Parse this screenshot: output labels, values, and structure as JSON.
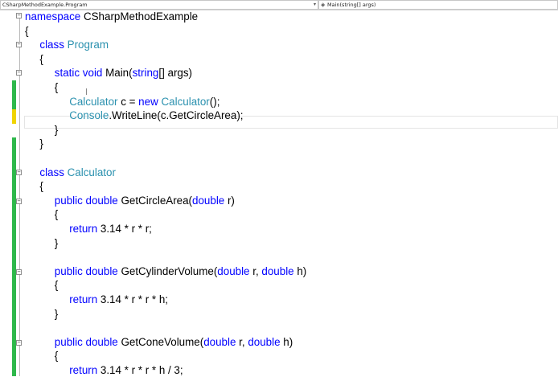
{
  "navbar": {
    "type_dropdown": "CSharpMethodExample.Program",
    "member_dropdown": "Main(string[] args)",
    "member_icon": "method-icon"
  },
  "code": {
    "lines": [
      {
        "indent": 0,
        "tokens": [
          {
            "t": "namespace",
            "c": "kw"
          },
          {
            "t": " CSharpMethodExample"
          }
        ]
      },
      {
        "indent": 0,
        "tokens": [
          {
            "t": "{"
          }
        ]
      },
      {
        "indent": 1,
        "tokens": [
          {
            "t": "class",
            "c": "kw"
          },
          {
            "t": " "
          },
          {
            "t": "Program",
            "c": "ty"
          }
        ]
      },
      {
        "indent": 1,
        "tokens": [
          {
            "t": "{"
          }
        ]
      },
      {
        "indent": 2,
        "tokens": [
          {
            "t": "static",
            "c": "kw"
          },
          {
            "t": " "
          },
          {
            "t": "void",
            "c": "kw"
          },
          {
            "t": " Main("
          },
          {
            "t": "string",
            "c": "kw"
          },
          {
            "t": "[] args)"
          }
        ]
      },
      {
        "indent": 2,
        "tokens": [
          {
            "t": "{"
          }
        ]
      },
      {
        "indent": 3,
        "tokens": [
          {
            "t": "Calculator",
            "c": "ty"
          },
          {
            "t": " c = "
          },
          {
            "t": "new",
            "c": "kw"
          },
          {
            "t": " "
          },
          {
            "t": "Calculator",
            "c": "ty"
          },
          {
            "t": "();"
          }
        ]
      },
      {
        "indent": 3,
        "tokens": [
          {
            "t": "Console",
            "c": "ty"
          },
          {
            "t": ".WriteLine(c.GetCircleArea);"
          }
        ]
      },
      {
        "indent": 2,
        "tokens": [
          {
            "t": "}"
          }
        ]
      },
      {
        "indent": 1,
        "tokens": [
          {
            "t": "}"
          }
        ]
      },
      {
        "indent": 0,
        "tokens": []
      },
      {
        "indent": 1,
        "tokens": [
          {
            "t": "class",
            "c": "kw"
          },
          {
            "t": " "
          },
          {
            "t": "Calculator",
            "c": "ty"
          }
        ]
      },
      {
        "indent": 1,
        "tokens": [
          {
            "t": "{"
          }
        ]
      },
      {
        "indent": 2,
        "tokens": [
          {
            "t": "public",
            "c": "kw"
          },
          {
            "t": " "
          },
          {
            "t": "double",
            "c": "kw"
          },
          {
            "t": " GetCircleArea("
          },
          {
            "t": "double",
            "c": "kw"
          },
          {
            "t": " r)"
          }
        ]
      },
      {
        "indent": 2,
        "tokens": [
          {
            "t": "{"
          }
        ]
      },
      {
        "indent": 3,
        "tokens": [
          {
            "t": "return",
            "c": "kw"
          },
          {
            "t": " 3.14 * r * r;"
          }
        ]
      },
      {
        "indent": 2,
        "tokens": [
          {
            "t": "}"
          }
        ]
      },
      {
        "indent": 0,
        "tokens": []
      },
      {
        "indent": 2,
        "tokens": [
          {
            "t": "public",
            "c": "kw"
          },
          {
            "t": " "
          },
          {
            "t": "double",
            "c": "kw"
          },
          {
            "t": " GetCylinderVolume("
          },
          {
            "t": "double",
            "c": "kw"
          },
          {
            "t": " r, "
          },
          {
            "t": "double",
            "c": "kw"
          },
          {
            "t": " h)"
          }
        ]
      },
      {
        "indent": 2,
        "tokens": [
          {
            "t": "{"
          }
        ]
      },
      {
        "indent": 3,
        "tokens": [
          {
            "t": "return",
            "c": "kw"
          },
          {
            "t": " 3.14 * r * r * h;"
          }
        ]
      },
      {
        "indent": 2,
        "tokens": [
          {
            "t": "}"
          }
        ]
      },
      {
        "indent": 0,
        "tokens": []
      },
      {
        "indent": 2,
        "tokens": [
          {
            "t": "public",
            "c": "kw"
          },
          {
            "t": " "
          },
          {
            "t": "double",
            "c": "kw"
          },
          {
            "t": " GetConeVolume("
          },
          {
            "t": "double",
            "c": "kw"
          },
          {
            "t": " r, "
          },
          {
            "t": "double",
            "c": "kw"
          },
          {
            "t": " h)"
          }
        ]
      },
      {
        "indent": 2,
        "tokens": [
          {
            "t": "{"
          }
        ]
      },
      {
        "indent": 3,
        "tokens": [
          {
            "t": "return",
            "c": "kw"
          },
          {
            "t": " 3.14 * r * r * h / 3;"
          }
        ]
      }
    ]
  },
  "colors": {
    "keyword": "#0000ff",
    "type": "#2b91af",
    "saved_change": "#2eb84b",
    "unsaved_change": "#f0d400"
  }
}
